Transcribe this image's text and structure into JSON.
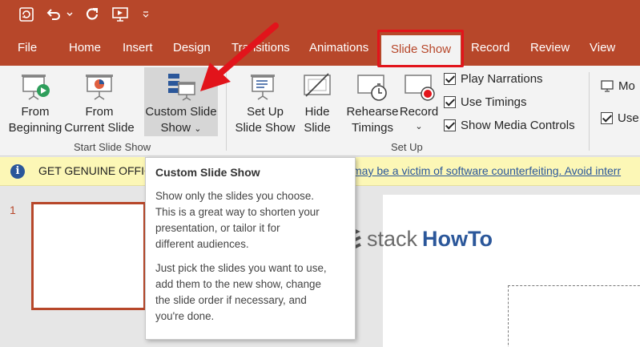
{
  "quick_access": {
    "icons": [
      "autosave-icon",
      "undo-icon",
      "undo-dropdown-icon",
      "redo-icon",
      "present-icon",
      "customize-qat-icon"
    ]
  },
  "tabs": [
    {
      "label": "File",
      "active": false
    },
    {
      "label": "Home",
      "active": false
    },
    {
      "label": "Insert",
      "active": false
    },
    {
      "label": "Design",
      "active": false
    },
    {
      "label": "Transitions",
      "active": false
    },
    {
      "label": "Animations",
      "active": false
    },
    {
      "label": "Slide Show",
      "active": true
    },
    {
      "label": "Record",
      "active": false
    },
    {
      "label": "Review",
      "active": false
    },
    {
      "label": "View",
      "active": false
    }
  ],
  "ribbon": {
    "start_group": {
      "label": "Start Slide Show",
      "from_beginning": {
        "line1": "From",
        "line2": "Beginning"
      },
      "from_current": {
        "line1": "From",
        "line2": "Current Slide"
      },
      "custom_show": {
        "line1": "Custom Slide",
        "line2": "Show",
        "chevron": "⌄"
      }
    },
    "setup_group": {
      "label": "Set Up",
      "set_up": {
        "line1": "Set Up",
        "line2": "Slide Show"
      },
      "hide": {
        "line1": "Hide",
        "line2": "Slide"
      },
      "rehearse": {
        "line1": "Rehearse",
        "line2": "Timings"
      },
      "record": {
        "line1": "Record",
        "chevron": "⌄"
      },
      "checks": [
        {
          "label": "Play Narrations",
          "checked": true
        },
        {
          "label": "Use Timings",
          "checked": true
        },
        {
          "label": "Show Media Controls",
          "checked": true
        }
      ]
    },
    "monitors_group": {
      "monitor_label": "Mo",
      "use_label": "Use",
      "use_checked": true
    }
  },
  "warning": {
    "title": "GET GENUINE OFFIC",
    "message": "may be a victim of software counterfeiting. Avoid interr"
  },
  "slides": {
    "first_number": "1"
  },
  "watermark": {
    "text1": "stack",
    "text2": "HowTo"
  },
  "tooltip": {
    "title": "Custom Slide Show",
    "para1_lines": [
      "Show only the slides you choose.",
      "This is a great way to shorten your",
      "presentation, or tailor it for",
      "different audiences."
    ],
    "para2_lines": [
      "Just pick the slides you want to use,",
      "add them to the new show, change",
      "the slide order if necessary, and",
      "you're done."
    ]
  },
  "colors": {
    "accent": "#b7472a",
    "highlight": "#e2141b",
    "warning_bg": "#fcf7b6",
    "link": "#2b579a"
  }
}
